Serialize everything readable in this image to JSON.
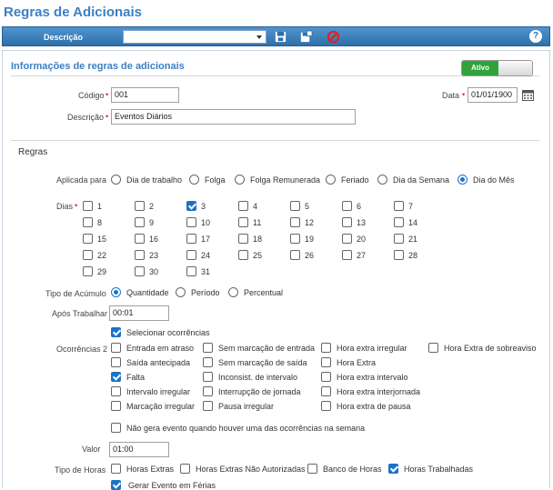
{
  "page": {
    "title": "Regras de Adicionais"
  },
  "toolbar": {
    "label": "Descrição",
    "select_value": "",
    "help": "?"
  },
  "info": {
    "title": "Informações de regras de adicionais",
    "status": "Ativo",
    "codigo_label": "Código",
    "codigo_value": "001",
    "descricao_label": "Descrição",
    "descricao_value": "Eventos Diários",
    "data_label": "Data",
    "data_value": "01/01/1900",
    "required_mark": "•"
  },
  "regras": {
    "title": "Regras",
    "aplicada_label": "Aplicada para",
    "aplicada_options": [
      {
        "label": "Dia de trabalho",
        "selected": false
      },
      {
        "label": "Folga",
        "selected": false
      },
      {
        "label": "Folga Remunerada",
        "selected": false
      },
      {
        "label": "Feriado",
        "selected": false
      },
      {
        "label": "Dia da Semana",
        "selected": false
      },
      {
        "label": "Dia do Mês",
        "selected": true
      }
    ],
    "dias_label": "Dias",
    "dias": [
      {
        "label": "1",
        "checked": false
      },
      {
        "label": "2",
        "checked": false
      },
      {
        "label": "3",
        "checked": true
      },
      {
        "label": "4",
        "checked": false
      },
      {
        "label": "5",
        "checked": false
      },
      {
        "label": "6",
        "checked": false
      },
      {
        "label": "7",
        "checked": false
      },
      {
        "label": "8",
        "checked": false
      },
      {
        "label": "9",
        "checked": false
      },
      {
        "label": "10",
        "checked": false
      },
      {
        "label": "11",
        "checked": false
      },
      {
        "label": "12",
        "checked": false
      },
      {
        "label": "13",
        "checked": false
      },
      {
        "label": "14",
        "checked": false
      },
      {
        "label": "15",
        "checked": false
      },
      {
        "label": "16",
        "checked": false
      },
      {
        "label": "17",
        "checked": false
      },
      {
        "label": "18",
        "checked": false
      },
      {
        "label": "19",
        "checked": false
      },
      {
        "label": "20",
        "checked": false
      },
      {
        "label": "21",
        "checked": false
      },
      {
        "label": "22",
        "checked": false
      },
      {
        "label": "23",
        "checked": false
      },
      {
        "label": "24",
        "checked": false
      },
      {
        "label": "25",
        "checked": false
      },
      {
        "label": "26",
        "checked": false
      },
      {
        "label": "27",
        "checked": false
      },
      {
        "label": "28",
        "checked": false
      },
      {
        "label": "29",
        "checked": false
      },
      {
        "label": "30",
        "checked": false
      },
      {
        "label": "31",
        "checked": false
      }
    ],
    "acumulo_label": "Tipo de Acúmulo",
    "acumulo_options": [
      {
        "label": "Quantidade",
        "selected": true
      },
      {
        "label": "Período",
        "selected": false
      },
      {
        "label": "Percentual",
        "selected": false
      }
    ],
    "apos_label": "Após Trabalhar",
    "apos_value": "00:01",
    "selecionar_label": "Selecionar ocorrências",
    "selecionar_checked": true,
    "ocorrencias_label": "Ocorrências 2",
    "ocorrencias": [
      {
        "label": "Entrada em atraso",
        "checked": false
      },
      {
        "label": "Sem marcação de entrada",
        "checked": false
      },
      {
        "label": "Hora extra irregular",
        "checked": false
      },
      {
        "label": "Hora Extra de sobreaviso",
        "checked": false
      },
      {
        "label": "Saída antecipada",
        "checked": false
      },
      {
        "label": "Sem marcação de saída",
        "checked": false
      },
      {
        "label": "Hora Extra",
        "checked": false
      },
      {
        "label": "Falta",
        "checked": true
      },
      {
        "label": "Inconsist. de intervalo",
        "checked": false
      },
      {
        "label": "Hora extra intervalo",
        "checked": false
      },
      {
        "label": "Intervalo irregular",
        "checked": false
      },
      {
        "label": "Interrupção de jornada",
        "checked": false
      },
      {
        "label": "Hora extra interjornada",
        "checked": false
      },
      {
        "label": "Marcação irregular",
        "checked": false
      },
      {
        "label": "Pausa irregular",
        "checked": false
      },
      {
        "label": "Hora extra de pausa",
        "checked": false
      }
    ],
    "nao_gera_label": "Não gera evento quando houver uma das ocorrências na semana",
    "nao_gera_checked": false,
    "valor_label": "Valor",
    "valor_value": "01:00",
    "tipo_horas_label": "Tipo de Horas",
    "tipo_horas": [
      {
        "label": "Horas Extras",
        "checked": false
      },
      {
        "label": "Horas Extras Não Autorizadas",
        "checked": false
      },
      {
        "label": "Banco de Horas",
        "checked": false
      },
      {
        "label": "Horas Trabalhadas",
        "checked": true
      }
    ],
    "ferias_label": "Gerar Evento em Férias",
    "ferias_checked": true
  },
  "colors": {
    "accent": "#3b7fc4",
    "checked": "#1a73c9",
    "active": "#2fa33a",
    "required": "#e02020"
  }
}
